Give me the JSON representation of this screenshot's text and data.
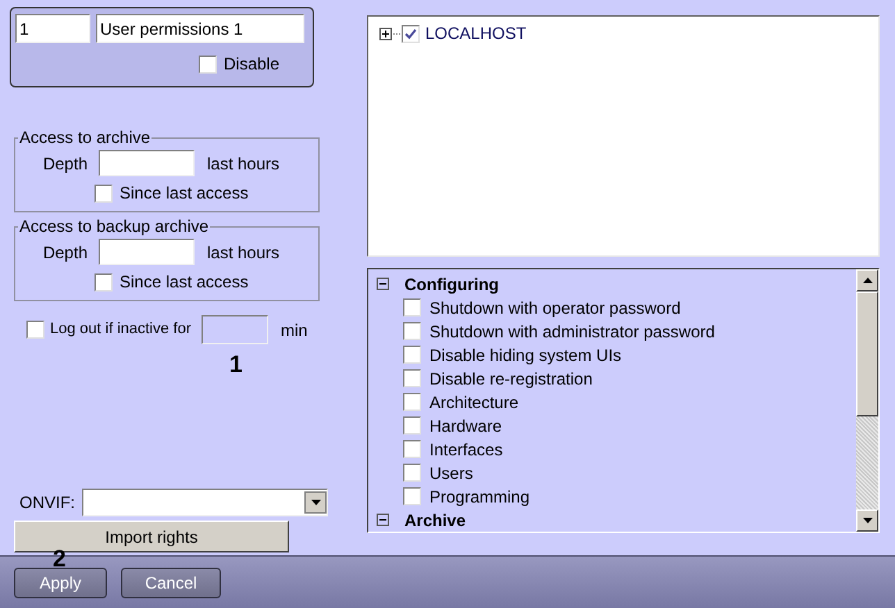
{
  "user": {
    "id": "1",
    "name": "User permissions 1",
    "disable": {
      "label": "Disable",
      "checked": false
    }
  },
  "archive_access": [
    {
      "title": "Access to archive",
      "depth_label": "Depth",
      "unit": "last hours",
      "since": {
        "label": "Since last access",
        "checked": false
      }
    },
    {
      "title": "Access to backup archive",
      "depth_label": "Depth",
      "unit": "last hours",
      "since": {
        "label": "Since last access",
        "checked": false
      }
    }
  ],
  "logout": {
    "label": "Log out if inactive for",
    "checked": false,
    "unit": "min"
  },
  "onvif": {
    "label": "ONVIF:"
  },
  "import_button": "Import rights",
  "tree": [
    {
      "label": "LOCALHOST",
      "expanded": false,
      "checked": true
    }
  ],
  "permissions": [
    {
      "kind": "group",
      "label": "Configuring",
      "expanded": true
    },
    {
      "kind": "item",
      "label": "Shutdown with operator password",
      "checked": false
    },
    {
      "kind": "item",
      "label": "Shutdown with administrator password",
      "checked": false
    },
    {
      "kind": "item",
      "label": "Disable hiding system UIs",
      "checked": false
    },
    {
      "kind": "item",
      "label": "Disable re-registration",
      "checked": false
    },
    {
      "kind": "item",
      "label": "Architecture",
      "checked": false
    },
    {
      "kind": "item",
      "label": "Hardware",
      "checked": false
    },
    {
      "kind": "item",
      "label": "Interfaces",
      "checked": false
    },
    {
      "kind": "item",
      "label": "Users",
      "checked": false
    },
    {
      "kind": "item",
      "label": "Programming",
      "checked": false
    },
    {
      "kind": "group",
      "label": "Archive",
      "expanded": true
    }
  ],
  "buttons": [
    "Apply",
    "Cancel"
  ],
  "callouts": [
    "1",
    "2"
  ]
}
